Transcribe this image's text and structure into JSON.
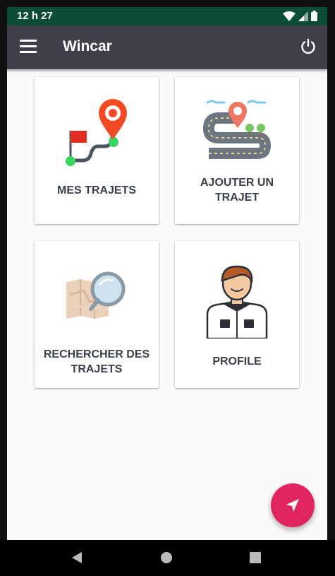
{
  "status_bar": {
    "time": "12 h 27"
  },
  "app_bar": {
    "title": "Wincar"
  },
  "cards": [
    {
      "label": "MES TRAJETS",
      "icon": "route-flag-pin-icon"
    },
    {
      "label": "AJOUTER UN TRAJET",
      "icon": "winding-road-icon"
    },
    {
      "label": "RECHERCHER DES TRAJETS",
      "icon": "map-magnifier-icon"
    },
    {
      "label": "PROFILE",
      "icon": "driver-avatar-icon"
    }
  ],
  "fab": {
    "icon": "navigation-arrow-icon"
  },
  "colors": {
    "status_bar": "#0c4d37",
    "app_bar": "#40404a",
    "fab": "#e0245e",
    "card_text": "#3a3f4b"
  }
}
